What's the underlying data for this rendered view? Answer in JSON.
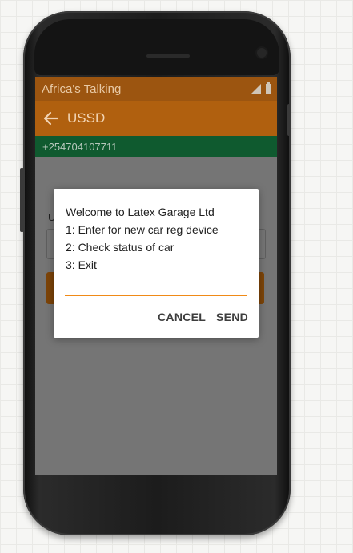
{
  "status_bar": {
    "carrier": "Africa's Talking",
    "icons": [
      "signal-icon",
      "battery-icon"
    ]
  },
  "app_bar": {
    "back_icon": "back-arrow-icon",
    "title": "USSD"
  },
  "phone_bar": {
    "number": "+254704107711"
  },
  "background_form": {
    "label_partial": "U"
  },
  "dialog": {
    "lines": [
      "Welcome to Latex Garage Ltd",
      "1: Enter for new car reg device",
      "2: Check status of car",
      "3: Exit"
    ],
    "input_value": "",
    "cancel_label": "CANCEL",
    "send_label": "SEND"
  },
  "colors": {
    "status_bar": "#9c5510",
    "app_bar": "#b0600f",
    "phone_bar": "#0f5a2f",
    "input_underline": "#f08a17",
    "background_button": "#7d4408"
  }
}
